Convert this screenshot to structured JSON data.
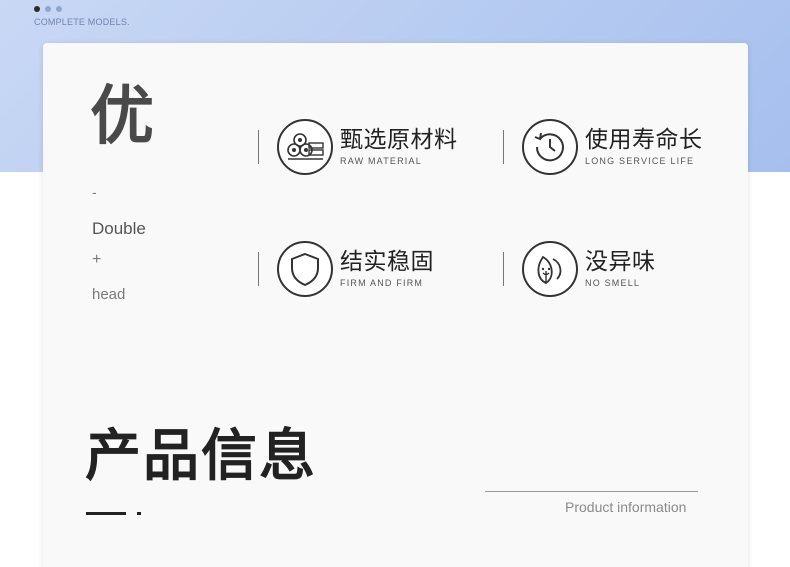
{
  "header": {
    "caption": "COMPLETE MODELS."
  },
  "carousel": {
    "dots": 3,
    "active_index": 0
  },
  "advantages": {
    "big_char": "优",
    "side": [
      "-",
      "Double",
      "+",
      "head"
    ]
  },
  "features": [
    {
      "cn": "甄选原材料",
      "en": "RAW MATERIAL",
      "icon": "raw-material-icon"
    },
    {
      "cn": "使用寿命长",
      "en": "LONG SERVICE LIFE",
      "icon": "clock-history-icon"
    },
    {
      "cn": "结实稳固",
      "en": "FIRM AND FIRM",
      "icon": "shield-icon"
    },
    {
      "cn": "没异味",
      "en": "NO SMELL",
      "icon": "leaf-icon"
    }
  ],
  "product_section": {
    "title": "产品信息",
    "subtitle": "Product information"
  },
  "colors": {
    "band": "#b9cdf2",
    "card": "#f9f9f9",
    "text_dark": "#222222"
  }
}
